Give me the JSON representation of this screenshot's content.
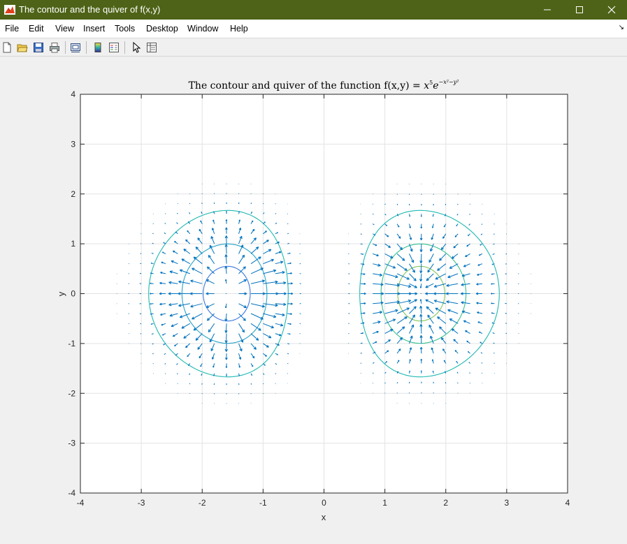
{
  "window": {
    "title": "The contour and the quiver of f(x,y)",
    "titlebar_color": "#4e6317"
  },
  "menubar": {
    "items": [
      "File",
      "Edit",
      "View",
      "Insert",
      "Tools",
      "Desktop",
      "Window",
      "Help"
    ]
  },
  "toolbar": {
    "icons": [
      "new-figure-icon",
      "open-file-icon",
      "save-icon",
      "print-icon",
      "print-preview-icon",
      "insert-colorbar-icon",
      "insert-legend-icon",
      "edit-plot-icon",
      "property-inspector-icon"
    ]
  },
  "chart_data": {
    "type": "contour+quiver",
    "title_prefix": "The contour and quiver of the function f(x,y) = ",
    "title_formula": {
      "base": "x",
      "exp1": "5",
      "base2": "e",
      "exp2": "−x²−y²"
    },
    "xlabel": "x",
    "ylabel": "y",
    "xlim": [
      -4,
      4
    ],
    "ylim": [
      -4,
      4
    ],
    "xticks": [
      -4,
      -3,
      -2,
      -1,
      0,
      1,
      2,
      3,
      4
    ],
    "yticks": [
      -4,
      -3,
      -2,
      -1,
      0,
      1,
      2,
      3,
      4
    ],
    "grid": true,
    "function": "f(x,y) = x^5 * exp(-x^2 - y^2)",
    "contour_levels": [
      -1.2,
      -0.9,
      -0.6,
      -0.3,
      -0.05,
      0.05,
      0.3,
      0.6,
      0.9,
      1.2
    ],
    "contour_colors": [
      "#3f1d9a",
      "#3b4ccf",
      "#3c78e0",
      "#2aa3c8",
      "#1fb9b0",
      "#1fb9b0",
      "#37c08e",
      "#83c55a",
      "#c9c13c",
      "#f2d02a"
    ],
    "quiver_color": "#0072bd",
    "quiver_spacing": 0.2
  }
}
